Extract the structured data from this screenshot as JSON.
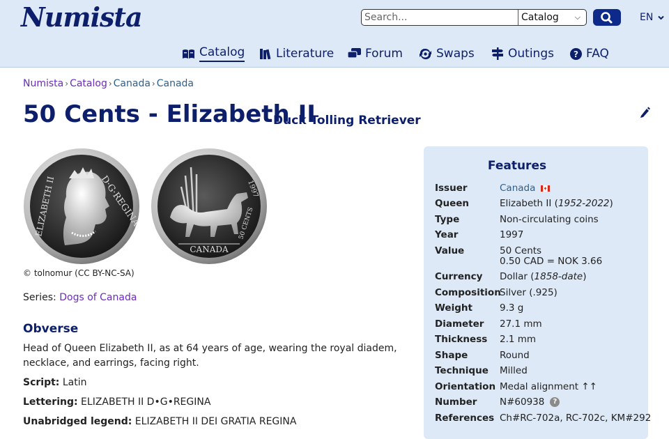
{
  "header": {
    "logo": "Numista",
    "search_placeholder": "Search...",
    "search_scope": "Catalog",
    "lang": "EN",
    "nav": [
      {
        "label": "Catalog",
        "icon": "catalog-book-icon"
      },
      {
        "label": "Literature",
        "icon": "books-icon"
      },
      {
        "label": "Forum",
        "icon": "forum-chat-icon"
      },
      {
        "label": "Swaps",
        "icon": "swaps-arrows-icon"
      },
      {
        "label": "Outings",
        "icon": "signpost-icon"
      },
      {
        "label": "FAQ",
        "icon": "question-circle-icon"
      }
    ]
  },
  "breadcrumb": [
    "Numista",
    "Catalog",
    "Canada",
    "Canada"
  ],
  "page": {
    "title": "50 Cents - Elizabeth II",
    "subtitle": "Duck Tolling Retriever",
    "photo_credit": "© tolnomur (CC BY-NC-SA)",
    "series_label": "Series:",
    "series_value": "Dogs of Canada"
  },
  "coin_obverse": {
    "top_text": "D·G·REGINA",
    "left_text": "ELIZABETH II"
  },
  "coin_reverse": {
    "bottom_text": "CANADA",
    "right_text": "50 CENTS",
    "year_text": "1997"
  },
  "obverse": {
    "heading": "Obverse",
    "description": "Head of Queen Elizabeth II, as at 64 years of age, wearing the royal diadem, necklace, and earrings, facing right.",
    "script_label": "Script:",
    "script_value": "Latin",
    "lettering_label": "Lettering:",
    "lettering_value": "ELIZABETH II D•G•REGINA",
    "legend_label": "Unabridged legend:",
    "legend_value": "ELIZABETH II DEI GRATIA REGINA"
  },
  "features": {
    "heading": "Features",
    "rows": [
      {
        "k": "Issuer",
        "v": "Canada"
      },
      {
        "k": "Queen",
        "v": "Elizabeth II (",
        "v_italic": "1952-2022",
        "v_end": ")"
      },
      {
        "k": "Type",
        "v": "Non-circulating coins"
      },
      {
        "k": "Year",
        "v": "1997"
      },
      {
        "k": "Value",
        "v": "50 Cents",
        "v2": "0.50 CAD = NOK 3.66"
      },
      {
        "k": "Currency",
        "v": "Dollar (",
        "v_italic": "1858-date",
        "v_end": ")"
      },
      {
        "k": "Composition",
        "v": "Silver (.925)"
      },
      {
        "k": "Weight",
        "v": "9.3 g"
      },
      {
        "k": "Diameter",
        "v": "27.1 mm"
      },
      {
        "k": "Thickness",
        "v": "2.1 mm"
      },
      {
        "k": "Shape",
        "v": "Round"
      },
      {
        "k": "Technique",
        "v": "Milled"
      },
      {
        "k": "Orientation",
        "v": "Medal alignment ↑↑"
      },
      {
        "k": "Number",
        "v": "N#60938"
      },
      {
        "k": "References",
        "v": "Ch#RC-702a, RC-702c, KM#292"
      }
    ]
  },
  "colors": {
    "header_bg": "#dde9f6",
    "brand_navy": "#0d1f6b",
    "link_blue": "#2f5f8a",
    "link_purple": "#6a2cc0"
  }
}
